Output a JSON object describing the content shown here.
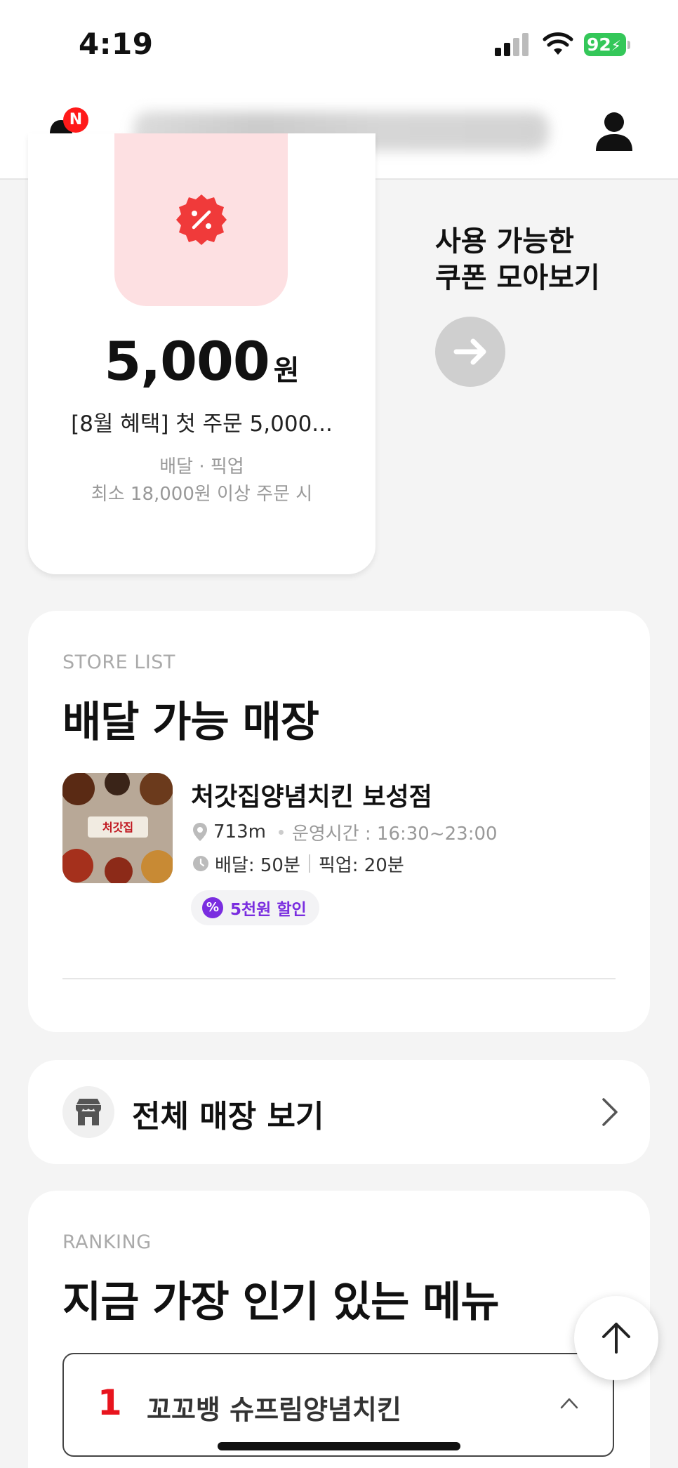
{
  "status_bar": {
    "time": "4:19",
    "battery_level": "92"
  },
  "header": {
    "notification_badge": "N"
  },
  "coupon": {
    "amount": "5,000",
    "unit": "원",
    "title": "[8월 혜택] 첫 주문 5,000...",
    "type": "배달 · 픽업",
    "min_order": "최소 18,000원 이상 주문 시",
    "more_title_line1": "사용 가능한",
    "more_title_line2": "쿠폰 모아보기"
  },
  "store_list": {
    "eyebrow": "STORE LIST",
    "title": "배달 가능 매장",
    "store": {
      "name": "처갓집양념치킨 보성점",
      "distance": "713m",
      "hours": "운영시간 : 16:30~23:00",
      "delivery": "배달: 50분",
      "pickup": "픽업: 20분",
      "discount": "5천원 할인",
      "thumb_text": "처갓집"
    }
  },
  "all_stores": {
    "label": "전체 매장 보기"
  },
  "ranking": {
    "eyebrow": "RANKING",
    "title": "지금 가장 인기 있는 메뉴",
    "items": [
      {
        "rank": "1",
        "name": "꼬꼬뱅 슈프림양념치킨"
      }
    ]
  },
  "colors": {
    "accent_red": "#e8141e",
    "coupon_red": "#f03a3a",
    "discount_purple": "#7a2de0",
    "battery_green": "#34c759"
  }
}
